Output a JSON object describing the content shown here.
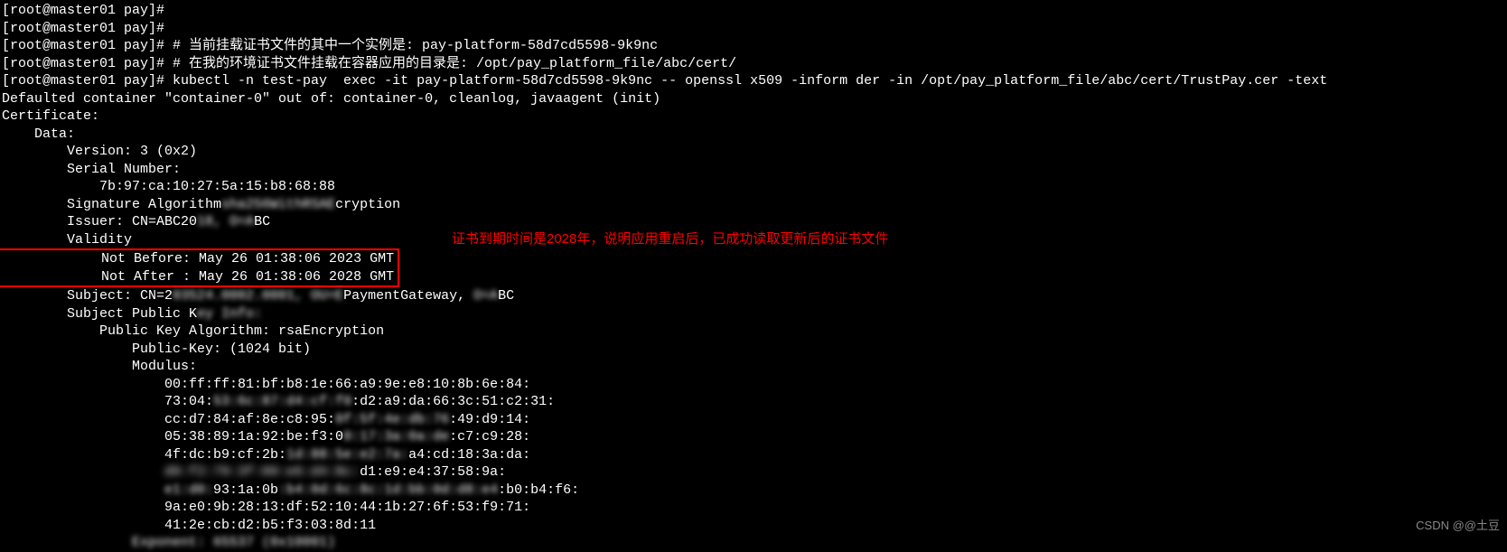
{
  "lines": {
    "l0": "[root@master01 pay]#",
    "l1": "[root@master01 pay]#",
    "l2": "[root@master01 pay]# # 当前挂载证书文件的其中一个实例是: pay-platform-58d7cd5598-9k9nc",
    "l3": "[root@master01 pay]# # 在我的环境证书文件挂载在容器应用的目录是: /opt/pay_platform_file/abc/cert/",
    "l4": "[root@master01 pay]# kubectl -n test-pay  exec -it pay-platform-58d7cd5598-9k9nc -- openssl x509 -inform der -in /opt/pay_platform_file/abc/cert/TrustPay.cer -text",
    "l5": "Defaulted container \"container-0\" out of: container-0, cleanlog, javaagent (init)",
    "l6": "Certificate:",
    "l7": "    Data:",
    "l8": "        Version: 3 (0x2)",
    "l9": "        Serial Number:",
    "l10": "            7b:97:ca:10:27:5a:15:b8:68:88",
    "l11a": "        Signature Algorithm",
    "l11b": "sha256WithRSAE",
    "l11c": "cryption",
    "l12a": "        Issuer: CN=ABC20",
    "l12b": "18, O=A",
    "l12c": "BC",
    "l13": "        Validity",
    "l14": "            Not Before: May 26 01:38:06 2023 GMT",
    "l15": "            Not After : May 26 01:38:06 2028 GMT",
    "l16a": "        Subject: CN=2",
    "l16b": "03524.0002.0001, OU=E",
    "l16c": "PaymentGateway, ",
    "l16d": "O=A",
    "l16e": "BC",
    "l17a": "        Subject Public K",
    "l17b": "ey Info:",
    "l18": "            Public Key Algorithm: rsaEncryption",
    "l19": "                Public-Key: (1024 bit)",
    "l20": "                Modulus:",
    "l21": "                    00:ff:ff:81:bf:b8:1e:66:a9:9e:e8:10:8b:6e:84:",
    "l22a": "                    73:04:",
    "l22b": "53:6c:87:d4:cf:f0",
    "l22c": ":d2:a9:da:66:3c:51:c2:31:",
    "l23a": "                    cc:d7:84:af:8e:c8:95:",
    "l23b": "0f:5f:4e:db:76",
    "l23c": ":49:d9:14:",
    "l24a": "                    05:38:89:1a:92:be:f3:0",
    "l24b": "0:17:3a:0a:de",
    "l24c": ":c7:c9:28:",
    "l25a": "                    4f:dc:b9:cf:2b:",
    "l25b": "1d:88:5e:e2:7a:",
    "l25c": "a4:cd:18:3a:da:",
    "l26a": "                    ",
    "l26b": "d9:f2:79:3f:09:e6:d4:8c:",
    "l26c": "d1:e9:e4:37:58:9a:",
    "l27a": "                    ",
    "l27b": "e1:d0:",
    "l27c": "93:1a:0b",
    "l27d": ":b4:0d:6c:8c:1d:bb:0d:d8:e4",
    "l27e": ":b0:b4:f6:",
    "l28": "                    9a:e0:9b:28:13:df:52:10:44:1b:27:6f:53:f9:71:",
    "l29": "                    41:2e:cb:d2:b5:f3:03:8d:11",
    "l30a": "                ",
    "l30b": "Exponent: 65537 (0x10001)"
  },
  "annotation": "证书到期时间是2028年，说明应用重启后，已成功读取更新后的证书文件",
  "watermark": "CSDN @@土豆"
}
